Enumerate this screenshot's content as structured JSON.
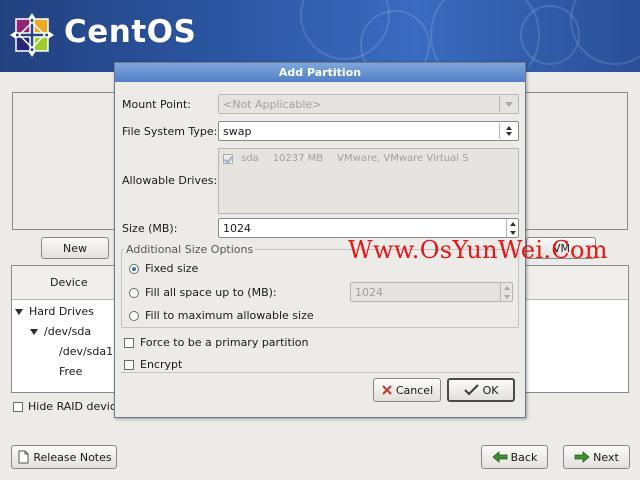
{
  "brand": {
    "logo_text": "CentOS",
    "banner_color": "#2c56a3",
    "logo_colors": [
      "#932279",
      "#efa724",
      "#262577",
      "#9ccd2a"
    ]
  },
  "background": {
    "new_button": "New",
    "lvm_button_partial": "VM",
    "device_column": "Device",
    "tree": [
      {
        "label": "Hard Drives",
        "expanded": true
      },
      {
        "label": "/dev/sda",
        "expanded": true
      },
      {
        "label": "/dev/sda1"
      },
      {
        "label": "Free"
      }
    ],
    "hide_raid_label": "Hide RAID device",
    "release_notes_button": "Release Notes",
    "back_button": "Back",
    "next_button": "Next"
  },
  "dialog": {
    "title": "Add Partition",
    "mount_point_label": "Mount Point:",
    "mount_point_value": "<Not Applicable>",
    "fs_type_label": "File System Type:",
    "fs_type_value": "swap",
    "allowable_drives_label": "Allowable Drives:",
    "drives": [
      {
        "name": "sda",
        "size": "10237 MB",
        "model": "VMware, VMware Virtual S",
        "checked": true
      }
    ],
    "size_label": "Size (MB):",
    "size_value": "1024",
    "additional_options_label": "Additional Size Options",
    "fixed_size_label": "Fixed size",
    "fill_up_to_label": "Fill all space up to (MB):",
    "fill_up_to_value": "1024",
    "fill_max_label": "Fill to maximum allowable size",
    "selected_size_option": "fixed",
    "force_primary_label": "Force to be a primary partition",
    "encrypt_label": "Encrypt",
    "cancel_button": "Cancel",
    "ok_button": "OK"
  },
  "watermark": {
    "text": "Www.OsYunWei.Com",
    "color": "#e81416"
  }
}
